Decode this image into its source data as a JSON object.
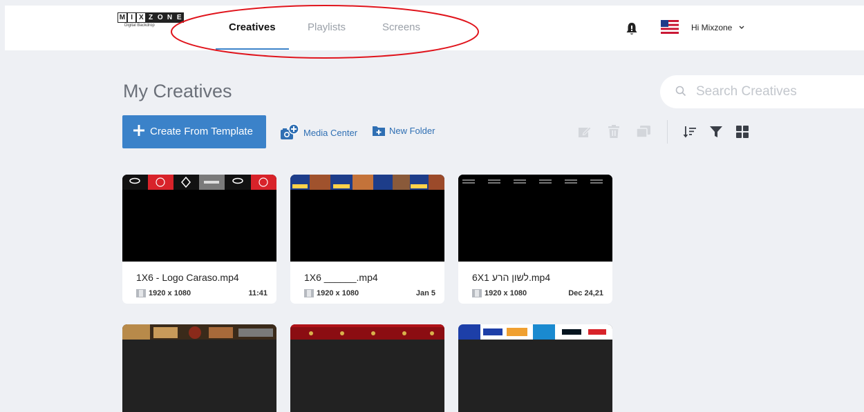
{
  "header": {
    "logo_letters": [
      "M",
      "I",
      "X",
      "Z",
      "O",
      "N",
      "E"
    ],
    "logo_subtitle": "Digital Backdrop",
    "tabs": [
      {
        "label": "Creatives",
        "active": true
      },
      {
        "label": "Playlists",
        "active": false
      },
      {
        "label": "Screens",
        "active": false
      }
    ],
    "greeting": "Hi Mixzone",
    "accent_color": "#3b82c9",
    "annotation_color": "#e0141c"
  },
  "page": {
    "title": "My Creatives",
    "search_placeholder": "Search Creatives"
  },
  "toolbar": {
    "create_label": "Create From Template",
    "media_center_label": "Media Center",
    "new_folder_label": "New Folder",
    "icons": [
      "edit-icon",
      "trash-icon",
      "copy-icon",
      "sort-icon",
      "filter-icon",
      "grid-view-icon"
    ]
  },
  "creatives": [
    {
      "name": "1X6 - Logo Caraso.mp4",
      "resolution": "1920 x 1080",
      "date": "11:41"
    },
    {
      "name": "1X6 ______.mp4",
      "resolution": "1920 x 1080",
      "date": "Jan 5"
    },
    {
      "name": "6X1 לשון הרע.mp4",
      "resolution": "1920 x 1080",
      "date": "Dec 24,21"
    }
  ],
  "creatives_row2_count": 3
}
